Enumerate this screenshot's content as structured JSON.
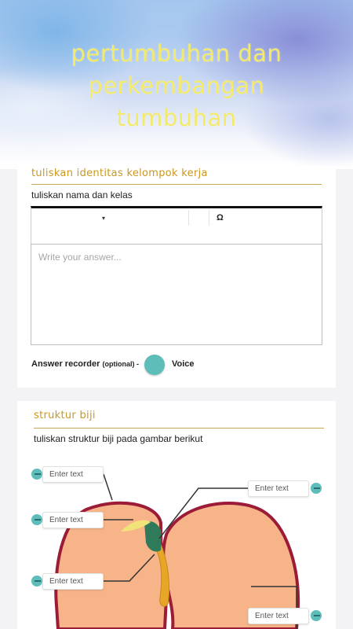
{
  "header": {
    "title": "pertumbuhan dan perkembangan tumbuhan"
  },
  "section1": {
    "title": "tuliskan identitas kelompok kerja",
    "description": "tuliskan nama dan kelas",
    "toolbar": {
      "caret": "▾",
      "omega": "Ω"
    },
    "answer_placeholder": "Write your answer...",
    "recorder_label": "Answer recorder",
    "recorder_optional": "(optional) -",
    "voice_label": "Voice"
  },
  "section2": {
    "title": "struktur biji",
    "description": "tuliskan struktur biji pada gambar berikut",
    "labels": [
      "Enter text",
      "Enter text",
      "Enter text",
      "Enter text",
      "Enter text"
    ]
  },
  "colors": {
    "title_yellow": "#f4ea6a",
    "section_gold": "#c99820",
    "teal": "#5cbdb9",
    "seed_fill": "#f6b488",
    "seed_outline": "#9c1c38"
  }
}
